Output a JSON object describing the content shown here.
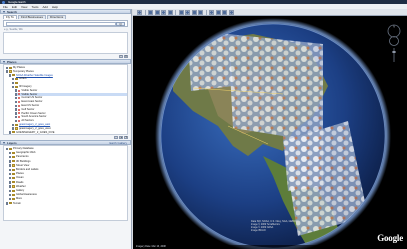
{
  "window": {
    "title": "Google Earth"
  },
  "menu": [
    "File",
    "Edit",
    "View",
    "Tools",
    "Add",
    "Help"
  ],
  "search": {
    "header": "Search",
    "tabs": [
      "Fly To",
      "Find Businesses",
      "Directions"
    ],
    "active_tab": "Fly To",
    "input_placeholder": "",
    "input_value": "",
    "hint": "e.g., Seattle, WA",
    "button_label": "Q"
  },
  "places": {
    "header": "Places",
    "sub_label": "",
    "items": [
      {
        "label": "My Places",
        "indent": 0,
        "checked": true
      },
      {
        "label": "Temporary Places",
        "indent": 0,
        "checked": true
      },
      {
        "label": "NOAA Weather Satellite Images",
        "indent": 1,
        "checked": true,
        "link": true
      },
      {
        "label": "GOES",
        "indent": 2,
        "checked": true
      },
      {
        "label": "",
        "indent": 2,
        "checked": false
      },
      {
        "label": "IR Imagery",
        "indent": 2,
        "checked": true
      },
      {
        "label": "Visible Sector",
        "indent": 3,
        "checked": true
      },
      {
        "label": "Visible Sector",
        "indent": 3,
        "checked": true,
        "selected": true
      },
      {
        "label": "Central US Sector",
        "indent": 3,
        "checked": false
      },
      {
        "label": "East-Coast Sector",
        "indent": 3,
        "checked": false
      },
      {
        "label": "East US Sector",
        "indent": 3,
        "checked": false
      },
      {
        "label": "Gulf Sector",
        "indent": 3,
        "checked": false
      },
      {
        "label": "Pacific Ocean Sector",
        "indent": 3,
        "checked": false
      },
      {
        "label": "South America Sector",
        "indent": 3,
        "checked": false
      },
      {
        "label": "All Sectors",
        "indent": 3,
        "checked": false
      },
      {
        "label": "goesimagery_2_goes_east",
        "indent": 2,
        "checked": true,
        "link": true
      },
      {
        "label": "goesimagery_2_goes_west",
        "indent": 2,
        "checked": false
      },
      {
        "label": "GOESIMAGERY_2_GOES_FIVE",
        "indent": 1,
        "checked": true
      }
    ]
  },
  "layers": {
    "header": "Layers",
    "sub_label": "Earth Gallery",
    "items": [
      {
        "label": "Primary Database",
        "indent": 0,
        "checked": true
      },
      {
        "label": "Geographic Web",
        "indent": 1,
        "checked": false
      },
      {
        "label": "Panoramio",
        "indent": 1,
        "checked": false
      },
      {
        "label": "3D Buildings",
        "indent": 1,
        "checked": false
      },
      {
        "label": "Street View",
        "indent": 1,
        "checked": false
      },
      {
        "label": "Borders and Labels",
        "indent": 1,
        "checked": true
      },
      {
        "label": "Places",
        "indent": 1,
        "checked": false
      },
      {
        "label": "Ocean",
        "indent": 1,
        "checked": false
      },
      {
        "label": "Roads",
        "indent": 1,
        "checked": false
      },
      {
        "label": "Weather",
        "indent": 1,
        "checked": false
      },
      {
        "label": "Gallery",
        "indent": 1,
        "checked": false
      },
      {
        "label": "Global Awareness",
        "indent": 1,
        "checked": false
      },
      {
        "label": "More",
        "indent": 1,
        "checked": false
      },
      {
        "label": "Terrain",
        "indent": 0,
        "checked": true
      }
    ]
  },
  "toolbar": {
    "buttons": [
      "sidebar",
      "placemark",
      "polygon",
      "path",
      "overlay",
      "tour",
      "history",
      "sun",
      "planets",
      "ruler",
      "email",
      "print",
      "maps"
    ]
  },
  "view": {
    "brand": "Google",
    "credits": [
      "Data SIO, NOAA, U.S. Navy, NGA, GEBCO",
      "Image © 2009 TerraMetrics",
      "Image © 2009 NASA",
      "Image IBCAO"
    ],
    "status": "Imagery Date: Mar 16, 2008",
    "colors": {
      "space": "#000000",
      "ocean": "#1c3f84",
      "land": "#5a6b3c",
      "cloud": "#e6e8ee"
    }
  }
}
